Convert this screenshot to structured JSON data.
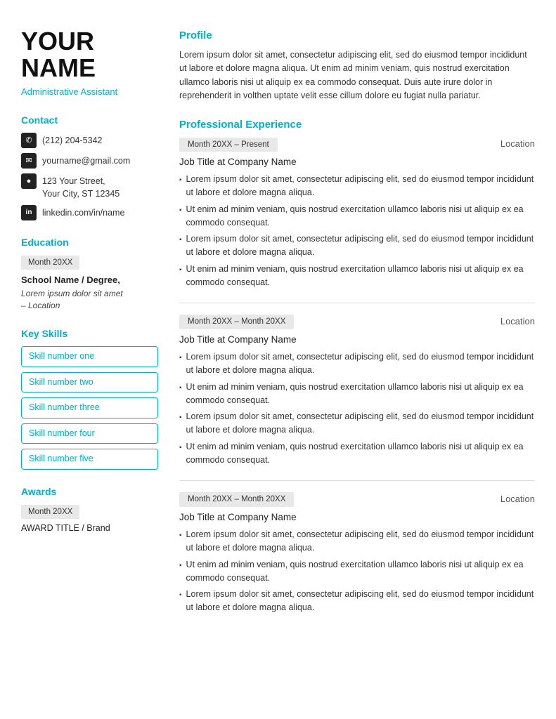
{
  "left": {
    "name_line1": "YOUR",
    "name_line2": "NAME",
    "subtitle": "Administrative Assistant",
    "contact_label": "Contact",
    "contacts": [
      {
        "icon": "phone",
        "text": "(212) 204-5342"
      },
      {
        "icon": "email",
        "text": "yourname@gmail.com"
      },
      {
        "icon": "location",
        "text": "123 Your Street,\nYour City, ST 12345"
      },
      {
        "icon": "linkedin",
        "text": "linkedin.com/in/name"
      }
    ],
    "education_label": "Education",
    "edu_date": "Month 20XX",
    "edu_school": "School Name / Degree,",
    "edu_detail": "Lorem ipsum dolor sit amet\n– Location",
    "skills_label": "Key Skills",
    "skills": [
      "Skill number one",
      "Skill number two",
      "Skill number three",
      "Skill number four",
      "Skill number five"
    ],
    "awards_label": "Awards",
    "award_date": "Month 20XX",
    "award_title": "AWARD TITLE / Brand"
  },
  "right": {
    "profile_label": "Profile",
    "profile_text": "Lorem ipsum dolor sit amet, consectetur adipiscing elit, sed do eiusmod tempor incididunt ut labore et dolore magna aliqua. Ut enim ad minim veniam, quis nostrud exercitation ullamco laboris nisi ut aliquip ex ea commodo consequat. Duis aute irure dolor in reprehenderit in volthen uptate velit esse cillum dolore eu fugiat nulla pariatur.",
    "experience_label": "Professional Experience",
    "experiences": [
      {
        "date": "Month 20XX – Present",
        "location": "Location",
        "job_title": "Job Title",
        "company": "at Company Name",
        "bullets": [
          "Lorem ipsum dolor sit amet, consectetur adipiscing elit, sed do eiusmod tempor incididunt ut labore et dolore magna aliqua.",
          "Ut enim ad minim veniam, quis nostrud exercitation ullamco laboris nisi ut aliquip ex ea commodo consequat.",
          "Lorem ipsum dolor sit amet, consectetur adipiscing elit, sed do eiusmod tempor incididunt ut labore et dolore magna aliqua.",
          "Ut enim ad minim veniam, quis nostrud exercitation ullamco laboris nisi ut aliquip ex ea commodo consequat."
        ]
      },
      {
        "date": "Month 20XX – Month 20XX",
        "location": "Location",
        "job_title": "Job Title",
        "company": "at Company Name",
        "bullets": [
          "Lorem ipsum dolor sit amet, consectetur adipiscing elit, sed do eiusmod tempor incididunt ut labore et dolore magna aliqua.",
          "Ut enim ad minim veniam, quis nostrud exercitation ullamco laboris nisi ut aliquip ex ea commodo consequat.",
          "Lorem ipsum dolor sit amet, consectetur adipiscing elit, sed do eiusmod tempor incididunt ut labore et dolore magna aliqua.",
          "Ut enim ad minim veniam, quis nostrud exercitation ullamco laboris nisi ut aliquip ex ea commodo consequat."
        ]
      },
      {
        "date": "Month 20XX – Month 20XX",
        "location": "Location",
        "job_title": "Job Title",
        "company": "at Company Name",
        "bullets": [
          "Lorem ipsum dolor sit amet, consectetur adipiscing elit, sed do eiusmod tempor incididunt ut labore et dolore magna aliqua.",
          "Ut enim ad minim veniam, quis nostrud exercitation ullamco laboris nisi ut aliquip ex ea commodo consequat.",
          "Lorem ipsum dolor sit amet, consectetur adipiscing elit, sed do eiusmod tempor incididunt ut labore et dolore magna aliqua."
        ]
      }
    ]
  }
}
